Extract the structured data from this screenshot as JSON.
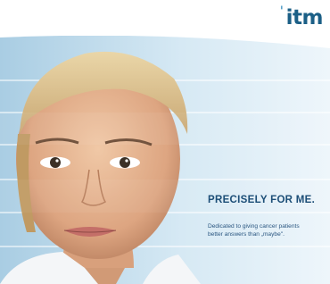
{
  "logo": {
    "text": "itm",
    "tick": "'"
  },
  "headline": "PRECISELY FOR ME.",
  "subline_1": "Dedicated to giving cancer patients",
  "subline_2": "better answers than „maybe\"."
}
